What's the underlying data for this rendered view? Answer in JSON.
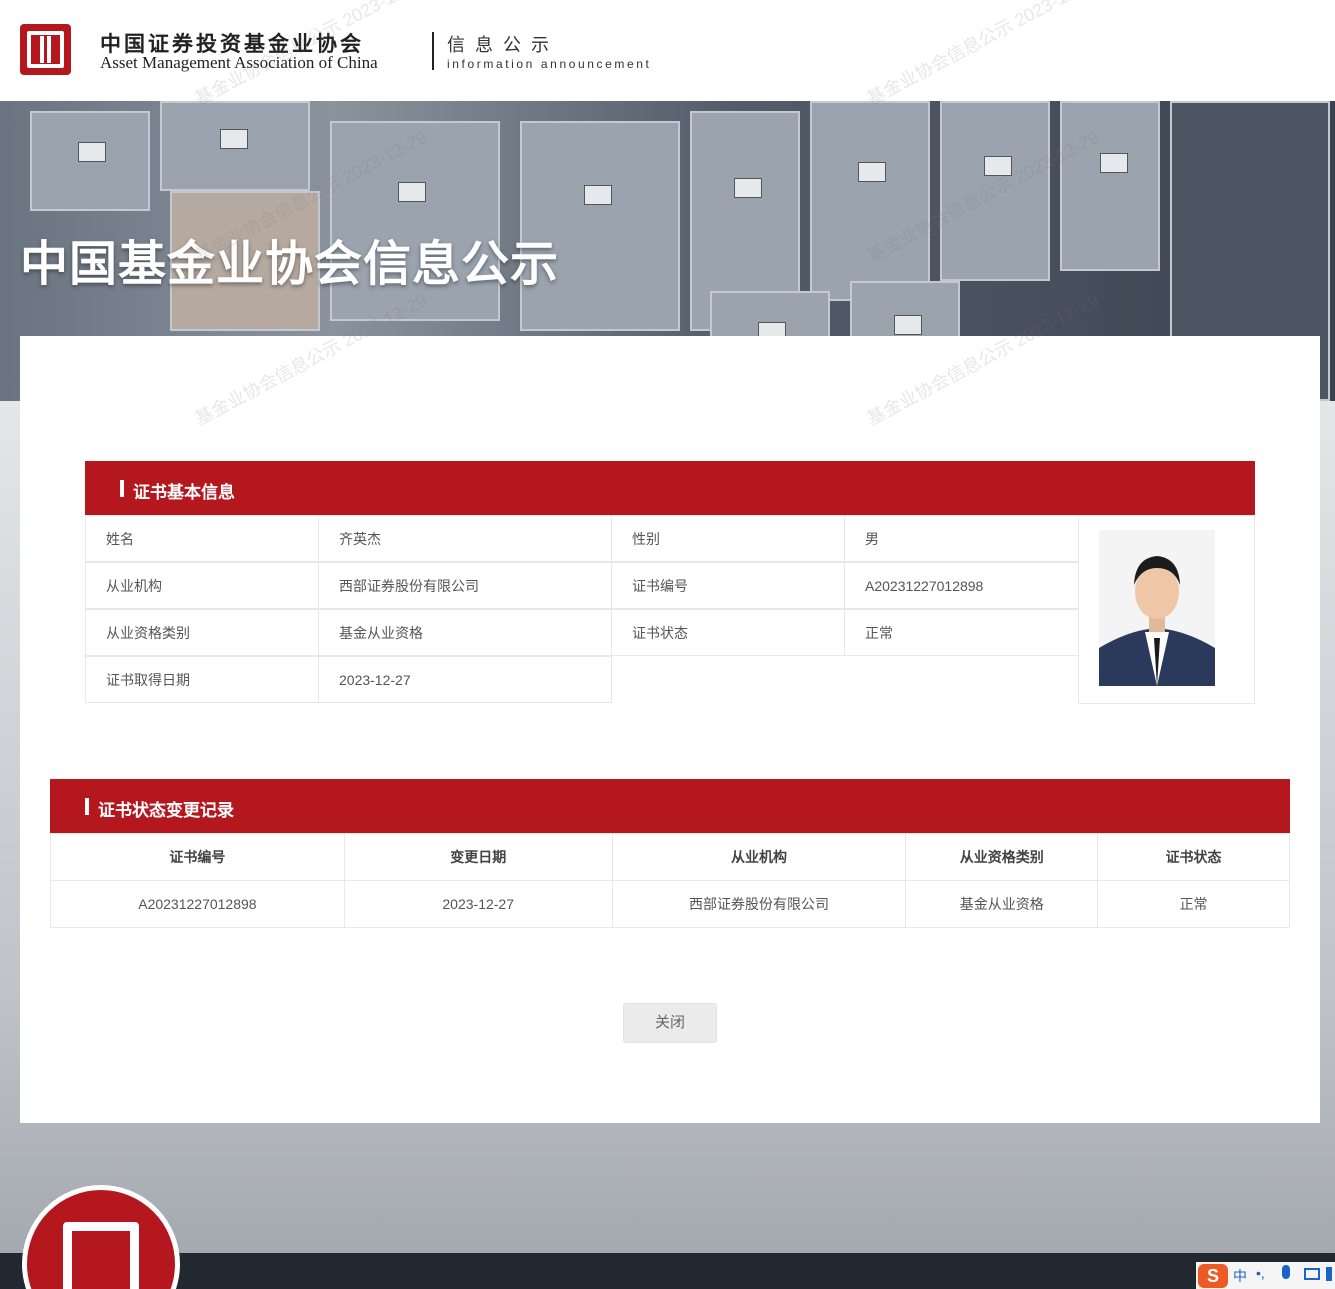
{
  "header": {
    "org_name_cn": "中国证券投资基金业协会",
    "org_name_en": "Asset Management Association of China",
    "section_cn": "信息公示",
    "section_en": "information announcement"
  },
  "banner": {
    "title": "中国基金业协会信息公示"
  },
  "watermark": {
    "text": "基金业协会信息公示 2023-12-29"
  },
  "cert_basic": {
    "heading": "证书基本信息",
    "labels": {
      "name": "姓名",
      "gender": "性别",
      "org": "从业机构",
      "cert_no": "证书编号",
      "qual_type": "从业资格类别",
      "cert_status": "证书状态",
      "obtain_date": "证书取得日期"
    },
    "values": {
      "name": "齐英杰",
      "gender": "男",
      "org": "西部证券股份有限公司",
      "cert_no": "A20231227012898",
      "qual_type": "基金从业资格",
      "cert_status": "正常",
      "obtain_date": "2023-12-27"
    }
  },
  "cert_history": {
    "heading": "证书状态变更记录",
    "columns": [
      "证书编号",
      "变更日期",
      "从业机构",
      "从业资格类别",
      "证书状态"
    ],
    "rows": [
      [
        "A20231227012898",
        "2023-12-27",
        "西部证券股份有限公司",
        "基金从业资格",
        "正常"
      ]
    ]
  },
  "actions": {
    "close_label": "关闭"
  },
  "ime": {
    "logo": "S",
    "mode": "中"
  },
  "colors": {
    "accent_red": "#b5171f",
    "footer_dark": "#222830"
  }
}
